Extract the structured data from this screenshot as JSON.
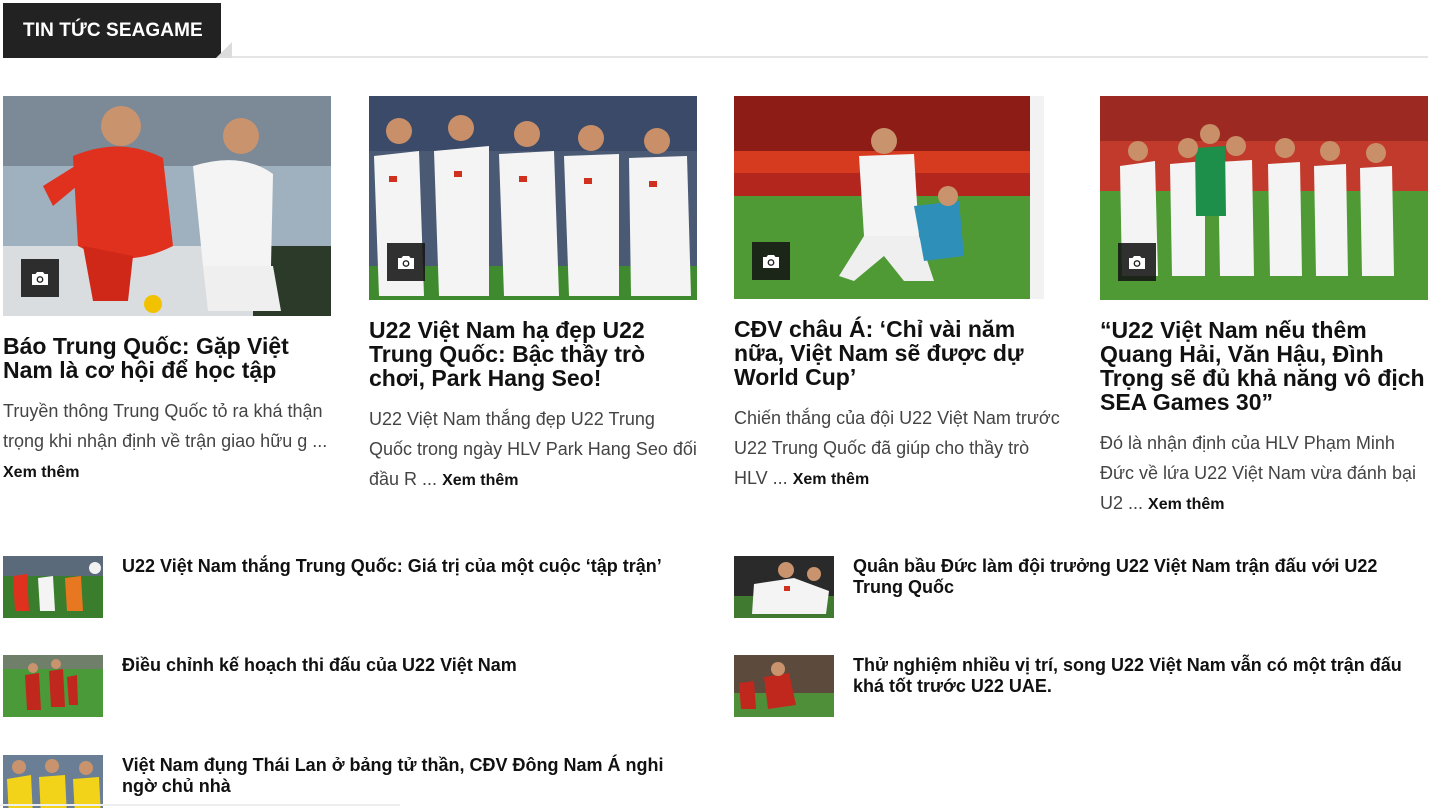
{
  "section": {
    "title": "TIN TỨC SEAGAME"
  },
  "featured": [
    {
      "title": "Báo Trung Quốc: Gặp Việt Nam là cơ hội để học tập",
      "excerpt": "Truyền thông Trung Quốc tỏ ra khá thận trọng khi nhận định về trận giao hữu g ...",
      "read_more": "Xem thêm",
      "icon": "camera-icon"
    },
    {
      "title": "U22 Việt Nam hạ đẹp U22 Trung Quốc: Bậc thầy trò chơi, Park Hang Seo!",
      "excerpt": "U22 Việt Nam thắng đẹp U22 Trung Quốc trong ngày HLV Park Hang Seo đối đầu R ...",
      "read_more": "Xem thêm",
      "icon": "camera-icon"
    },
    {
      "title": "CĐV châu Á: ‘Chỉ vài năm nữa, Việt Nam sẽ được dự World Cup’",
      "excerpt": "Chiến thắng của đội U22 Việt Nam trước U22 Trung Quốc đã giúp cho thầy trò HLV ...",
      "read_more": "Xem thêm",
      "icon": "camera-icon"
    },
    {
      "title": "“U22 Việt Nam nếu thêm Quang Hải, Văn Hậu, Đình Trọng sẽ đủ khả năng vô địch SEA Games 30”",
      "excerpt": "Đó là nhận định của HLV Phạm Minh Đức về lứa U22 Việt Nam vừa đánh bại U2 ...",
      "read_more": "Xem thêm",
      "icon": "camera-icon"
    }
  ],
  "list": [
    {
      "title": "U22 Việt Nam thắng Trung Quốc: Giá trị của một cuộc ‘tập trận’"
    },
    {
      "title": "Quân bầu Đức làm đội trưởng U22 Việt Nam trận đấu với U22 Trung Quốc"
    },
    {
      "title": "Điều chỉnh kế hoạch thi đấu của U22 Việt Nam"
    },
    {
      "title": "Thử nghiệm nhiều vị trí, song U22 Việt Nam vẫn có một trận đấu khá tốt trước U22 UAE."
    },
    {
      "title": "Việt Nam đụng Thái Lan ở bảng tử thần, CĐV Đông Nam Á nghi ngờ chủ nhà"
    }
  ],
  "colors": {
    "header_bg": "#222222",
    "jersey_red": "#e0301e",
    "jersey_white": "#f4f4f4",
    "pitch_green": "#3f8a2e"
  }
}
